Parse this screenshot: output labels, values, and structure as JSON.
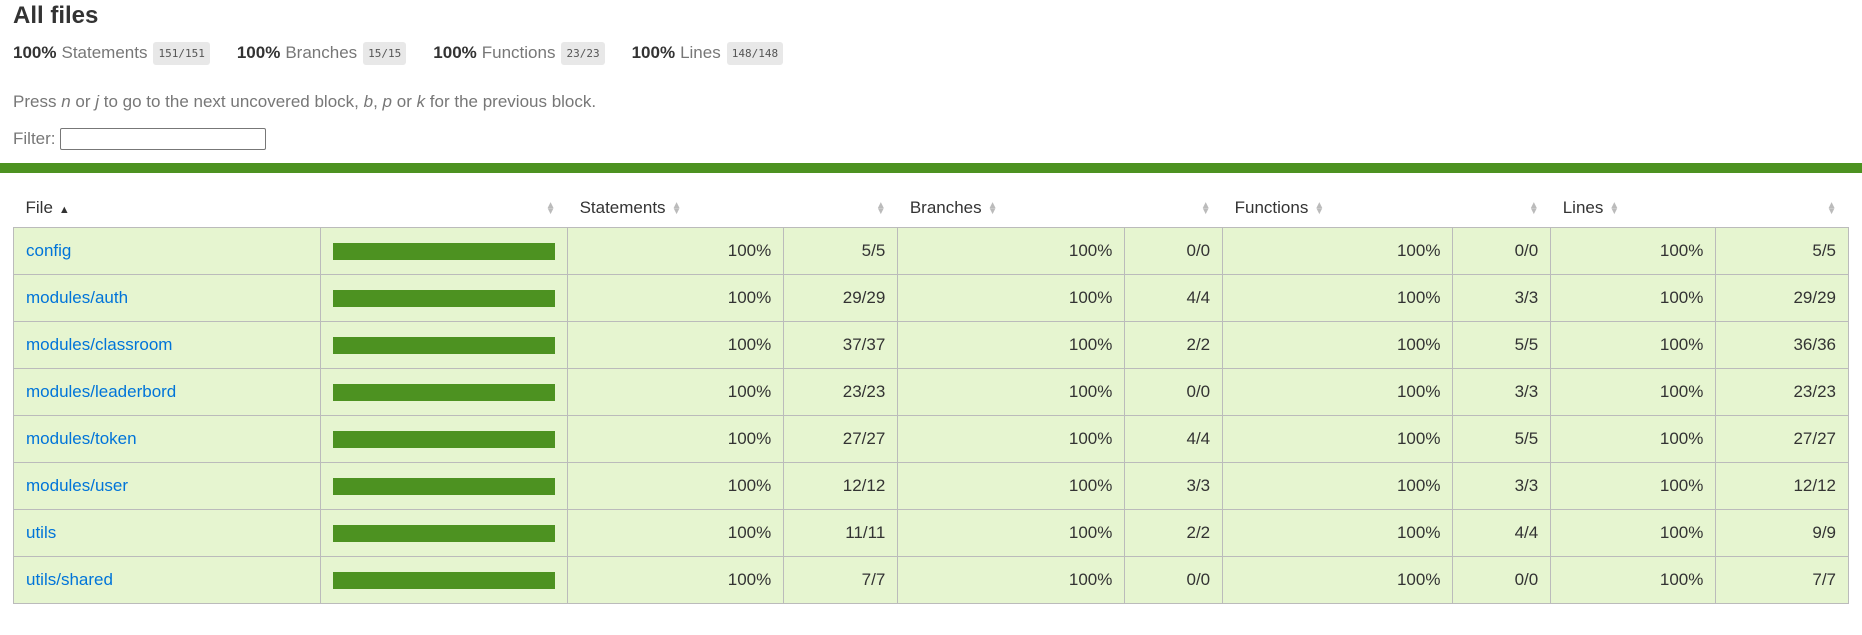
{
  "page": {
    "title": "All files"
  },
  "summary": [
    {
      "pct": "100%",
      "label": "Statements",
      "fraction": "151/151"
    },
    {
      "pct": "100%",
      "label": "Branches",
      "fraction": "15/15"
    },
    {
      "pct": "100%",
      "label": "Functions",
      "fraction": "23/23"
    },
    {
      "pct": "100%",
      "label": "Lines",
      "fraction": "148/148"
    }
  ],
  "hint": {
    "t1": "Press ",
    "k1": "n",
    "t2": " or ",
    "k2": "j",
    "t3": " to go to the next uncovered block, ",
    "k3": "b",
    "t4": ", ",
    "k4": "p",
    "t5": " or ",
    "k5": "k",
    "t6": " for the previous block."
  },
  "filter": {
    "label": "Filter:",
    "value": ""
  },
  "colors": {
    "high": "#4d9221",
    "row_bg": "#e6f5d0",
    "link": "#0074d9"
  },
  "table": {
    "headers": {
      "file": "File",
      "statements": "Statements",
      "branches": "Branches",
      "functions": "Functions",
      "lines": "Lines"
    },
    "sort": {
      "column": "File",
      "direction": "ascending"
    },
    "rows": [
      {
        "file": "config",
        "coverage": 100,
        "s_pct": "100%",
        "s_frac": "5/5",
        "b_pct": "100%",
        "b_frac": "0/0",
        "f_pct": "100%",
        "f_frac": "0/0",
        "l_pct": "100%",
        "l_frac": "5/5"
      },
      {
        "file": "modules/auth",
        "coverage": 100,
        "s_pct": "100%",
        "s_frac": "29/29",
        "b_pct": "100%",
        "b_frac": "4/4",
        "f_pct": "100%",
        "f_frac": "3/3",
        "l_pct": "100%",
        "l_frac": "29/29"
      },
      {
        "file": "modules/classroom",
        "coverage": 100,
        "s_pct": "100%",
        "s_frac": "37/37",
        "b_pct": "100%",
        "b_frac": "2/2",
        "f_pct": "100%",
        "f_frac": "5/5",
        "l_pct": "100%",
        "l_frac": "36/36"
      },
      {
        "file": "modules/leaderbord",
        "coverage": 100,
        "s_pct": "100%",
        "s_frac": "23/23",
        "b_pct": "100%",
        "b_frac": "0/0",
        "f_pct": "100%",
        "f_frac": "3/3",
        "l_pct": "100%",
        "l_frac": "23/23"
      },
      {
        "file": "modules/token",
        "coverage": 100,
        "s_pct": "100%",
        "s_frac": "27/27",
        "b_pct": "100%",
        "b_frac": "4/4",
        "f_pct": "100%",
        "f_frac": "5/5",
        "l_pct": "100%",
        "l_frac": "27/27"
      },
      {
        "file": "modules/user",
        "coverage": 100,
        "s_pct": "100%",
        "s_frac": "12/12",
        "b_pct": "100%",
        "b_frac": "3/3",
        "f_pct": "100%",
        "f_frac": "3/3",
        "l_pct": "100%",
        "l_frac": "12/12"
      },
      {
        "file": "utils",
        "coverage": 100,
        "s_pct": "100%",
        "s_frac": "11/11",
        "b_pct": "100%",
        "b_frac": "2/2",
        "f_pct": "100%",
        "f_frac": "4/4",
        "l_pct": "100%",
        "l_frac": "9/9"
      },
      {
        "file": "utils/shared",
        "coverage": 100,
        "s_pct": "100%",
        "s_frac": "7/7",
        "b_pct": "100%",
        "b_frac": "0/0",
        "f_pct": "100%",
        "f_frac": "0/0",
        "l_pct": "100%",
        "l_frac": "7/7"
      }
    ]
  }
}
